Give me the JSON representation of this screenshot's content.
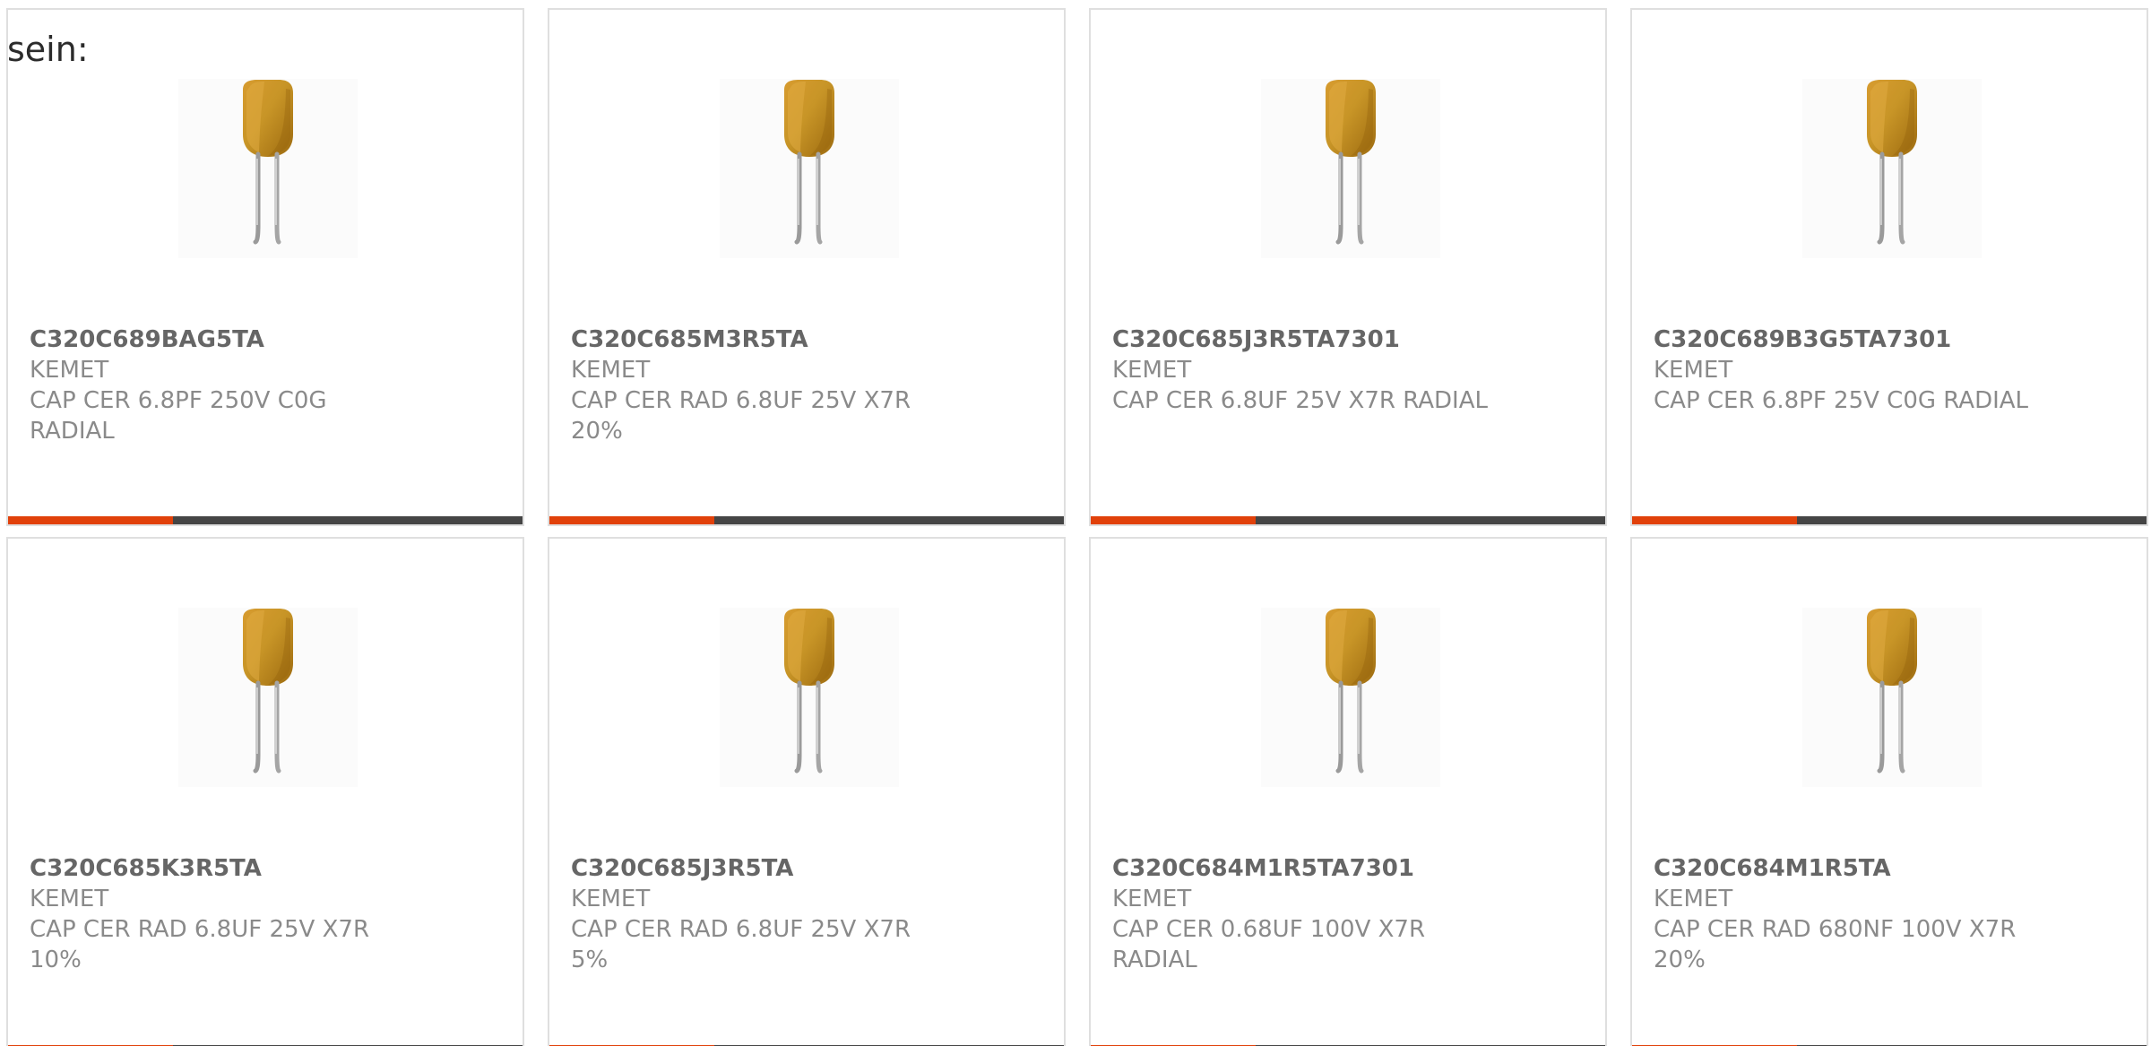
{
  "intro_text": "sein:",
  "accent_color": "#e1410a",
  "bar_color": "#454545",
  "products": [
    {
      "part_number": "C320C689BAG5TA",
      "manufacturer": "KEMET",
      "description": "CAP CER 6.8PF 250V C0G RADIAL",
      "image_icon": "radial-capacitor-icon",
      "progress": 0.32
    },
    {
      "part_number": "C320C685M3R5TA",
      "manufacturer": "KEMET",
      "description": "CAP CER RAD 6.8UF 25V X7R 20%",
      "image_icon": "radial-capacitor-icon",
      "progress": 0.32
    },
    {
      "part_number": "C320C685J3R5TA7301",
      "manufacturer": "KEMET",
      "description": "CAP CER 6.8UF 25V X7R RADIAL",
      "image_icon": "radial-capacitor-icon",
      "progress": 0.32
    },
    {
      "part_number": "C320C689B3G5TA7301",
      "manufacturer": "KEMET",
      "description": "CAP CER 6.8PF 25V C0G RADIAL",
      "image_icon": "radial-capacitor-icon",
      "progress": 0.32
    },
    {
      "part_number": "C320C685K3R5TA",
      "manufacturer": "KEMET",
      "description": "CAP CER RAD 6.8UF 25V X7R 10%",
      "image_icon": "radial-capacitor-icon",
      "progress": 0.32
    },
    {
      "part_number": "C320C685J3R5TA",
      "manufacturer": "KEMET",
      "description": "CAP CER RAD 6.8UF 25V X7R 5%",
      "image_icon": "radial-capacitor-icon",
      "progress": 0.32
    },
    {
      "part_number": "C320C684M1R5TA7301",
      "manufacturer": "KEMET",
      "description": "CAP CER 0.68UF 100V X7R RADIAL",
      "image_icon": "radial-capacitor-icon",
      "progress": 0.32
    },
    {
      "part_number": "C320C684M1R5TA",
      "manufacturer": "KEMET",
      "description": "CAP CER RAD 680NF 100V X7R 20%",
      "image_icon": "radial-capacitor-icon",
      "progress": 0.32
    }
  ]
}
